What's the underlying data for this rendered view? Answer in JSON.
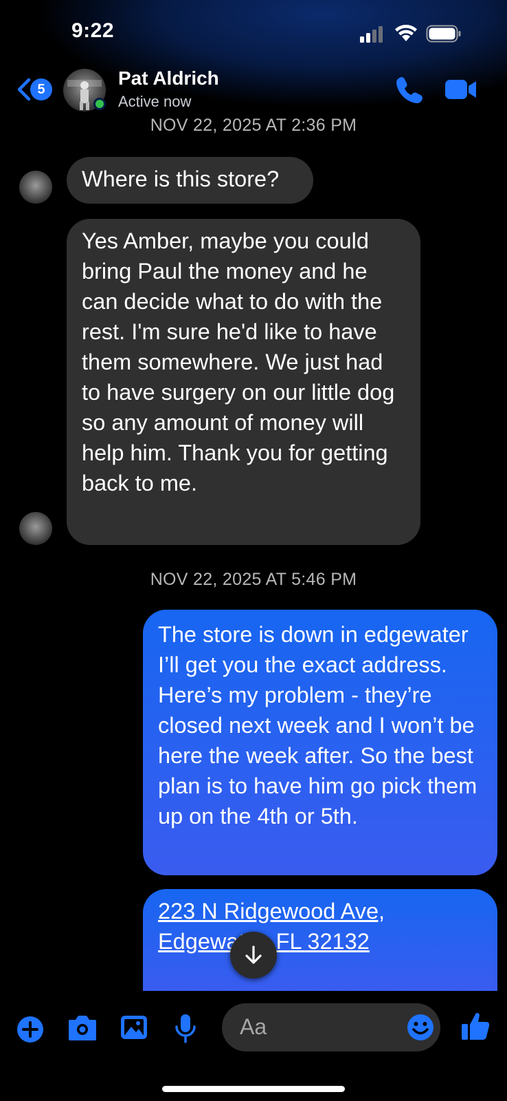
{
  "status_bar": {
    "time": "9:22"
  },
  "header": {
    "unread_count": "5",
    "contact_name": "Pat Aldrich",
    "presence": "Active now"
  },
  "conversation": {
    "timestamp_1": "NOV 22, 2025 AT 2:36 PM",
    "msg_1": "Where is this store?",
    "msg_2": "Yes Amber, maybe you could bring Paul the money and he can decide what to do with the rest. I'm sure he'd like to have them somewhere. We just had to have surgery on our little dog so any amount of money will help him. Thank you for getting back to me.",
    "timestamp_2": "NOV 22, 2025 AT 5:46 PM",
    "msg_3": "The store is down in edgewater I’ll get you the exact address. Here’s my problem - they’re closed next week and I won’t be here the week after. So the best plan is to have him go pick them up on the 4th or 5th.",
    "msg_4_line1": "223 N Ridgewood Ave,",
    "msg_4_line2": "Edgewater, FL 32132"
  },
  "composer": {
    "placeholder": "Aa"
  },
  "colors": {
    "accent": "#1f73ff",
    "outgoing_bubble": "#2f63f0",
    "incoming_bubble": "#303030",
    "online": "#31c24d"
  },
  "icons": [
    "back-chevron-icon",
    "phone-icon",
    "video-camera-icon",
    "arrow-down-icon",
    "plus-icon",
    "camera-icon",
    "image-icon",
    "microphone-icon",
    "smiley-icon",
    "thumbs-up-icon"
  ]
}
